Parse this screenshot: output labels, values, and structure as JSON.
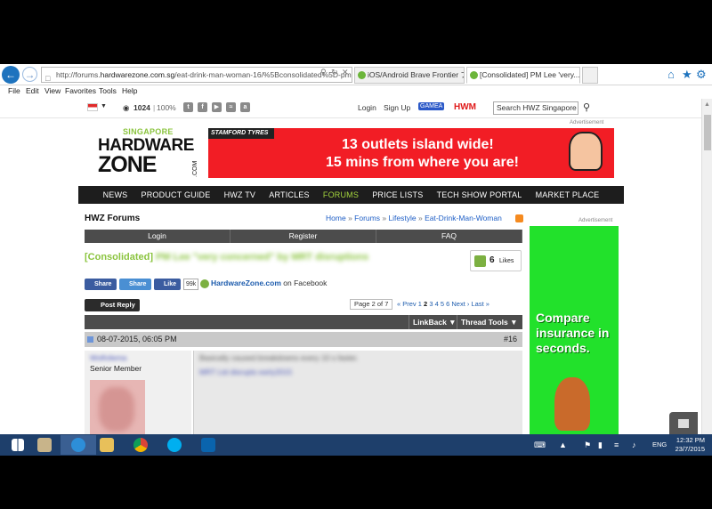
{
  "browser": {
    "url_prefix": "http://forums.",
    "url_domain": "hardwarezone.com.sg",
    "url_rest": "/eat-drink-man-woman-16/%5Bconsolidated%5D-pm",
    "tabs": [
      {
        "label": "iOS/Android Brave Frontier ブ..."
      },
      {
        "label": "[Consolidated] PM Lee 'very..."
      }
    ],
    "menu": [
      "File",
      "Edit",
      "View",
      "Favorites",
      "Tools",
      "Help"
    ]
  },
  "site": {
    "util": {
      "count": "1024",
      "percent": "100%",
      "login": "Login",
      "signup": "Sign Up",
      "gamea": "GAMEA",
      "hwm": "HWM",
      "search_placeholder": "Search HWZ Singapore"
    },
    "advertisement_label": "Advertisement",
    "logo": {
      "line1": "SINGAPORE",
      "line2": "HARDWARE",
      "line3": "ZONE",
      "line4": ".COM"
    },
    "banner": {
      "brand": "STAMFORD TYRES",
      "line1": "13 outlets island wide!",
      "line2": "15 mins from where you are!"
    },
    "nav": [
      "NEWS",
      "PRODUCT GUIDE",
      "HWZ TV",
      "ARTICLES",
      "FORUMS",
      "PRICE LISTS",
      "TECH SHOW PORTAL",
      "MARKET PLACE"
    ],
    "forum_title": "HWZ Forums",
    "breadcrumb": [
      "Home",
      "Forums",
      "Lifestyle",
      "Eat-Drink-Man-Woman"
    ],
    "loginbar": [
      "Login",
      "Register",
      "FAQ"
    ],
    "thread": {
      "prefix": "[Consolidated]",
      "rest": "PM Lee \"very concerned\" by MRT disruptions",
      "likes": "6",
      "likes_label": "Likes"
    },
    "share": {
      "fb_share": "Share",
      "tw_share": "Share",
      "fb_like": "Like",
      "fb_count": "99k",
      "hwz_name": "HardwareZone.com",
      "hwz_suffix": "on Facebook"
    },
    "post_reply": "Post Reply",
    "page_info": "Page 2 of 7",
    "pager": {
      "prev": "« Prev",
      "pages": [
        "1",
        "2",
        "3",
        "4",
        "5",
        "6"
      ],
      "current": "2",
      "next": "Next ›",
      "last": "Last »"
    },
    "thread_tools": {
      "linkback": "LinkBack",
      "tools": "Thread Tools"
    },
    "post": {
      "date": "08-07-2015, 06:05 PM",
      "number": "#16",
      "username": "Wolfvilema",
      "rank": "Senior Member",
      "line1": "Basically caused breakdowns every 10 s faster.",
      "line2": "MRT Ltd disrupts early2015"
    },
    "side_ad": {
      "text": "Compare insurance in seconds."
    }
  },
  "taskbar": {
    "lang": "ENG",
    "time": "12:32 PM",
    "date": "23/7/2015"
  }
}
